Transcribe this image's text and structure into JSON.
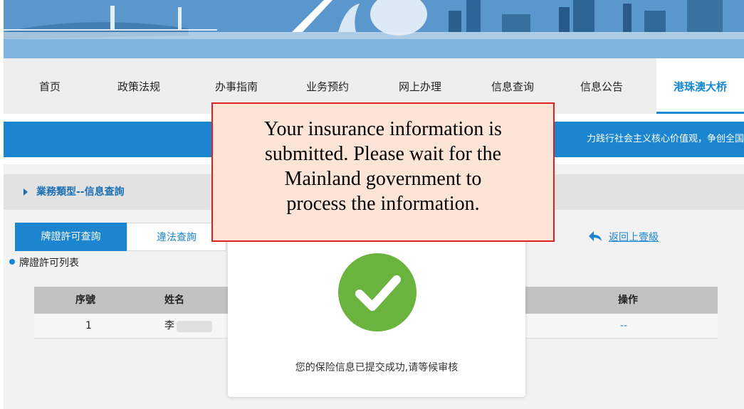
{
  "nav": {
    "items": [
      {
        "label": "首页"
      },
      {
        "label": "政策法规"
      },
      {
        "label": "办事指南"
      },
      {
        "label": "业务预约"
      },
      {
        "label": "网上办理"
      },
      {
        "label": "信息查询"
      },
      {
        "label": "信息公告"
      },
      {
        "label": "港珠澳大桥"
      }
    ],
    "active_index": 7
  },
  "strip": {
    "text": "力践行社会主义核心价值观，争创全国"
  },
  "section": {
    "title": "業務類型--信息查詢"
  },
  "tabs": [
    {
      "label": "牌證許可查詢"
    },
    {
      "label": "違法查詢"
    }
  ],
  "back_link": "返回上壹級",
  "list_label": "牌證許可列表",
  "table": {
    "headers": [
      "序號",
      "姓名",
      "操作"
    ],
    "rows": [
      {
        "index": "1",
        "name": "李",
        "action": "--"
      }
    ]
  },
  "modal": {
    "message": "您的保险信息已提交成功,请等候审核",
    "icon": "check-circle-icon"
  },
  "callout": {
    "lines": [
      "Your insurance information is",
      "submitted. Please wait for the",
      "Mainland government to",
      "process the information."
    ]
  },
  "colors": {
    "accent": "#1b86cf",
    "success": "#6ab33f",
    "callout_bg": "#fce4d6",
    "callout_border": "#e02020"
  }
}
